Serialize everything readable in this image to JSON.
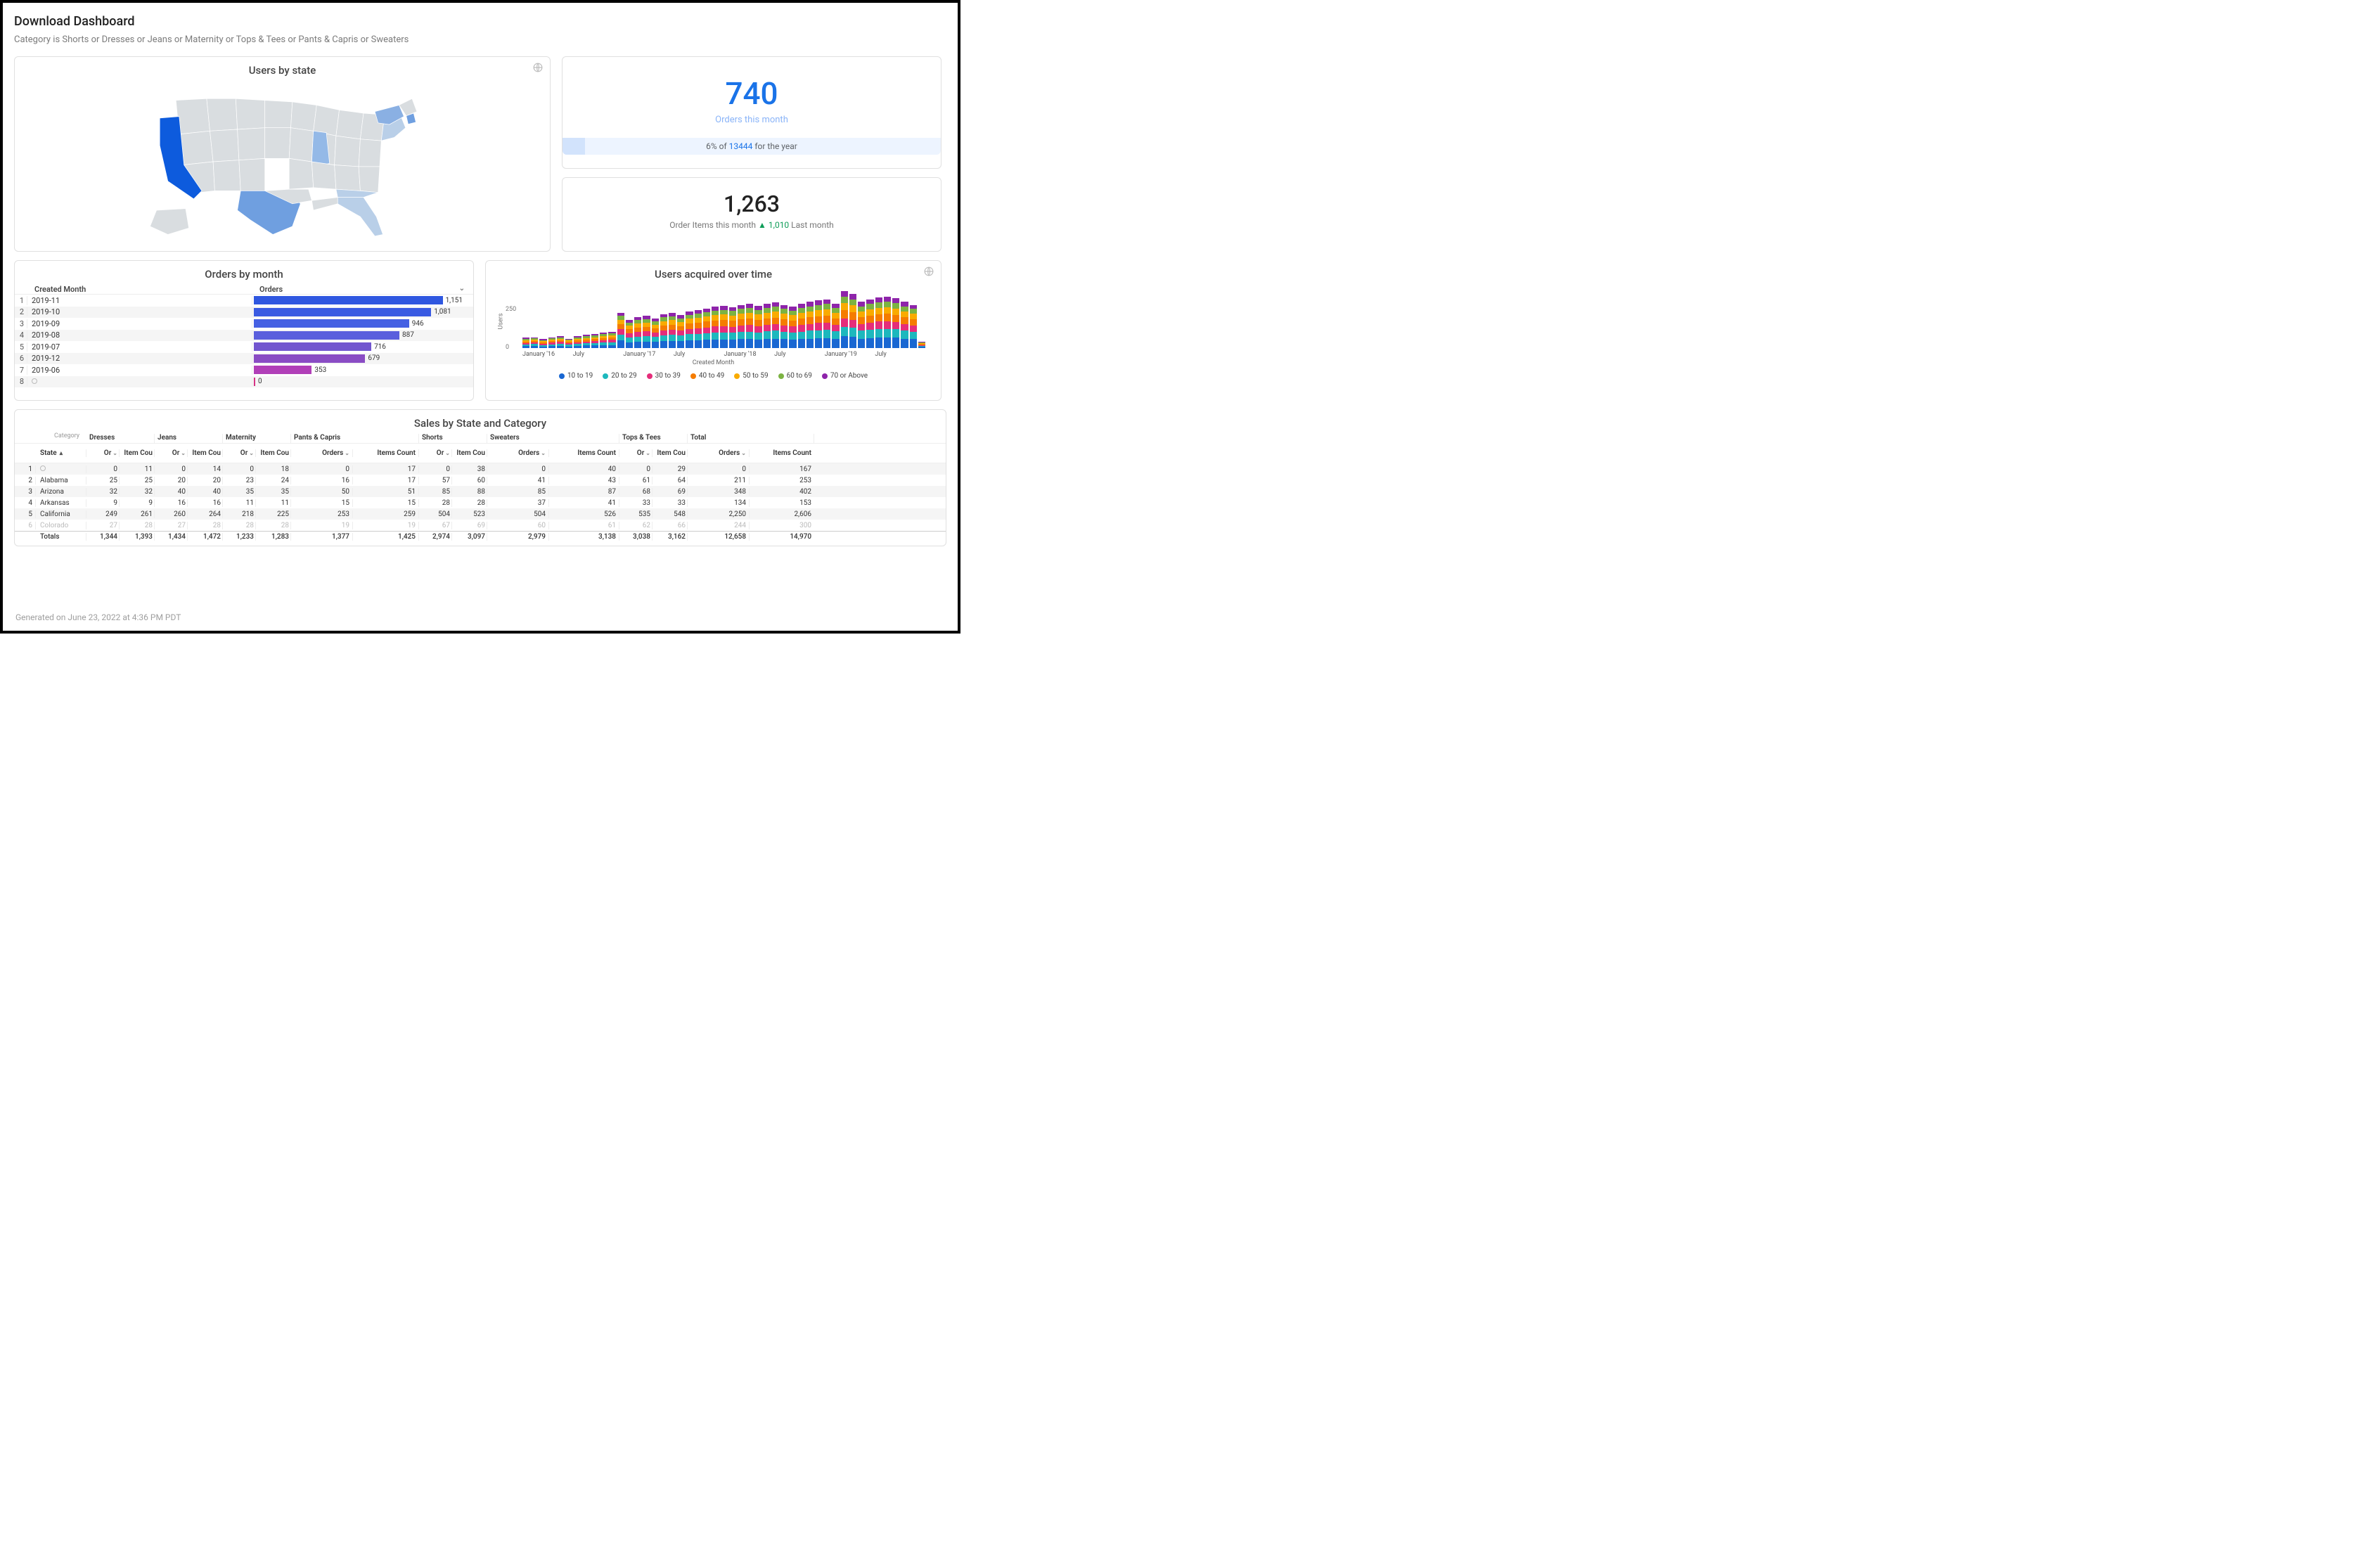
{
  "title": "Download Dashboard",
  "subtitle": "Category is Shorts or Dresses or Jeans or Maternity or Tops & Tees or Pants & Capris or Sweaters",
  "footer": "Generated on June 23, 2022 at 4:36 PM PDT",
  "tiles": {
    "map": {
      "title": "Users by state"
    },
    "kpi1": {
      "value": "740",
      "caption": "Orders this month",
      "bar_pct": "6%",
      "bar_of": "of",
      "bar_total": "13444",
      "bar_suffix": "for the year"
    },
    "kpi2": {
      "value": "1,263",
      "prefix": "Order Items this month",
      "delta": "▲ 1,010",
      "suffix": "Last month"
    },
    "orders_by_month": {
      "title": "Orders by month",
      "h_created_month": "Created Month",
      "h_orders": "Orders"
    },
    "users_acquired": {
      "title": "Users acquired over time",
      "ylabel": "Users",
      "xlabel": "Created Month"
    },
    "sales": {
      "title": "Sales by State and Category",
      "h_category": "Category",
      "h_state": "State",
      "h_orders_short": "Orders",
      "h_items_short": "Items Count",
      "h_totals": "Totals",
      "h_total": "Total"
    }
  },
  "chart_data": {
    "orders_by_month": {
      "type": "bar",
      "max": 1200,
      "rows": [
        {
          "idx": 1,
          "label": "2019-11",
          "value": 1151,
          "value_txt": "1,151",
          "color": "#2f57e0"
        },
        {
          "idx": 2,
          "label": "2019-10",
          "value": 1081,
          "value_txt": "1,081",
          "color": "#3a5be2"
        },
        {
          "idx": 3,
          "label": "2019-09",
          "value": 946,
          "value_txt": "946",
          "color": "#4560e3"
        },
        {
          "idx": 4,
          "label": "2019-08",
          "value": 887,
          "value_txt": "887",
          "color": "#5a5fdd"
        },
        {
          "idx": 5,
          "label": "2019-07",
          "value": 716,
          "value_txt": "716",
          "color": "#7256cf"
        },
        {
          "idx": 6,
          "label": "2019-12",
          "value": 679,
          "value_txt": "679",
          "color": "#8a4cc4"
        },
        {
          "idx": 7,
          "label": "2019-06",
          "value": 353,
          "value_txt": "353",
          "color": "#b13fb8"
        },
        {
          "idx": 8,
          "label": "",
          "value": 0,
          "value_txt": "0",
          "color": "#d63384",
          "null_label": true
        }
      ]
    },
    "users_acquired": {
      "type": "stacked-bar",
      "ylim": [
        0,
        400
      ],
      "yticks": [
        0,
        250
      ],
      "xlabels": [
        "January '16",
        "July",
        "January '17",
        "July",
        "January '18",
        "July",
        "January '19",
        "July"
      ],
      "legend": [
        {
          "label": "10 to 19",
          "color": "#1967d2"
        },
        {
          "label": "20 to 29",
          "color": "#1db8bd"
        },
        {
          "label": "30 to 39",
          "color": "#e52d7a"
        },
        {
          "label": "40 to 49",
          "color": "#f57c00"
        },
        {
          "label": "50 to 59",
          "color": "#f9ab00"
        },
        {
          "label": "60 to 69",
          "color": "#7cb342"
        },
        {
          "label": "70 or Above",
          "color": "#8e24aa"
        }
      ],
      "columns": [
        [
          12,
          10,
          9,
          10,
          9,
          8,
          7
        ],
        [
          14,
          11,
          10,
          10,
          9,
          8,
          7
        ],
        [
          10,
          9,
          8,
          8,
          8,
          7,
          6
        ],
        [
          13,
          11,
          10,
          10,
          9,
          8,
          7
        ],
        [
          15,
          12,
          11,
          11,
          10,
          9,
          8
        ],
        [
          11,
          10,
          9,
          9,
          8,
          7,
          6
        ],
        [
          14,
          12,
          11,
          11,
          10,
          9,
          8
        ],
        [
          16,
          13,
          12,
          12,
          11,
          10,
          9
        ],
        [
          17,
          14,
          13,
          13,
          12,
          10,
          9
        ],
        [
          19,
          16,
          14,
          14,
          13,
          11,
          10
        ],
        [
          20,
          17,
          15,
          15,
          13,
          12,
          10
        ],
        [
          48,
          38,
          34,
          32,
          28,
          24,
          20
        ],
        [
          36,
          30,
          27,
          26,
          23,
          20,
          17
        ],
        [
          40,
          32,
          29,
          28,
          25,
          22,
          19
        ],
        [
          42,
          34,
          30,
          29,
          26,
          23,
          19
        ],
        [
          38,
          31,
          28,
          27,
          24,
          21,
          18
        ],
        [
          44,
          36,
          32,
          31,
          27,
          24,
          20
        ],
        [
          46,
          37,
          33,
          32,
          28,
          25,
          21
        ],
        [
          43,
          35,
          31,
          30,
          27,
          23,
          20
        ],
        [
          48,
          39,
          35,
          33,
          30,
          26,
          22
        ],
        [
          50,
          40,
          36,
          34,
          31,
          27,
          23
        ],
        [
          52,
          42,
          37,
          36,
          32,
          28,
          24
        ],
        [
          54,
          44,
          39,
          37,
          34,
          29,
          25
        ],
        [
          55,
          45,
          40,
          38,
          34,
          30,
          25
        ],
        [
          53,
          43,
          39,
          37,
          33,
          29,
          25
        ],
        [
          56,
          46,
          41,
          39,
          35,
          30,
          26
        ],
        [
          57,
          47,
          42,
          40,
          36,
          31,
          26
        ],
        [
          55,
          45,
          40,
          38,
          34,
          30,
          25
        ],
        [
          58,
          48,
          42,
          40,
          36,
          31,
          27
        ],
        [
          60,
          49,
          43,
          41,
          37,
          32,
          27
        ],
        [
          56,
          46,
          41,
          39,
          35,
          30,
          26
        ],
        [
          54,
          44,
          39,
          38,
          34,
          29,
          25
        ],
        [
          57,
          47,
          42,
          40,
          36,
          31,
          26
        ],
        [
          60,
          49,
          44,
          42,
          37,
          32,
          28
        ],
        [
          62,
          51,
          45,
          43,
          39,
          33,
          28
        ],
        [
          64,
          52,
          46,
          44,
          40,
          34,
          29
        ],
        [
          58,
          48,
          42,
          40,
          36,
          31,
          27
        ],
        [
          74,
          60,
          54,
          51,
          46,
          40,
          34
        ],
        [
          70,
          57,
          51,
          49,
          44,
          38,
          32
        ],
        [
          60,
          49,
          44,
          42,
          37,
          32,
          28
        ],
        [
          64,
          52,
          46,
          44,
          40,
          34,
          29
        ],
        [
          66,
          54,
          48,
          46,
          41,
          35,
          30
        ],
        [
          67,
          55,
          49,
          46,
          42,
          36,
          30
        ],
        [
          65,
          53,
          47,
          45,
          41,
          35,
          30
        ],
        [
          60,
          49,
          44,
          42,
          37,
          32,
          28
        ],
        [
          56,
          46,
          41,
          39,
          35,
          30,
          26
        ],
        [
          8,
          6,
          6,
          5,
          5,
          4,
          4
        ]
      ]
    },
    "sales_table": {
      "categories": [
        "Dresses",
        "Jeans",
        "Maternity",
        "Pants & Capris",
        "Shorts",
        "Sweaters",
        "Tops & Tees",
        "Total"
      ],
      "columns_per_cat": [
        "Orders",
        "Items Count"
      ],
      "rows": [
        {
          "idx": 1,
          "state_null": true,
          "cells": [
            0,
            11,
            0,
            14,
            0,
            18,
            0,
            17,
            0,
            38,
            0,
            40,
            0,
            29,
            0,
            167
          ]
        },
        {
          "idx": 2,
          "state": "Alabama",
          "cells": [
            25,
            25,
            20,
            20,
            23,
            24,
            16,
            17,
            57,
            60,
            41,
            43,
            61,
            64,
            211,
            253
          ]
        },
        {
          "idx": 3,
          "state": "Arizona",
          "cells": [
            32,
            32,
            40,
            40,
            35,
            35,
            50,
            51,
            85,
            88,
            85,
            87,
            68,
            69,
            348,
            402
          ]
        },
        {
          "idx": 4,
          "state": "Arkansas",
          "cells": [
            9,
            9,
            16,
            16,
            11,
            11,
            15,
            15,
            28,
            28,
            37,
            41,
            33,
            33,
            134,
            153
          ]
        },
        {
          "idx": 5,
          "state": "California",
          "cells": [
            249,
            261,
            260,
            264,
            218,
            225,
            253,
            259,
            504,
            523,
            504,
            526,
            535,
            548,
            "2,250",
            "2,606"
          ]
        },
        {
          "idx": 6,
          "state": "Colorado",
          "cells": [
            27,
            28,
            27,
            28,
            28,
            28,
            19,
            19,
            67,
            69,
            60,
            61,
            62,
            66,
            244,
            300
          ],
          "faded": true
        }
      ],
      "totals": [
        "1,344",
        "1,393",
        "1,434",
        "1,472",
        "1,233",
        "1,283",
        "1,377",
        "1,425",
        "2,974",
        "3,097",
        "2,979",
        "3,138",
        "3,038",
        "3,162",
        "12,658",
        "14,970"
      ]
    }
  }
}
